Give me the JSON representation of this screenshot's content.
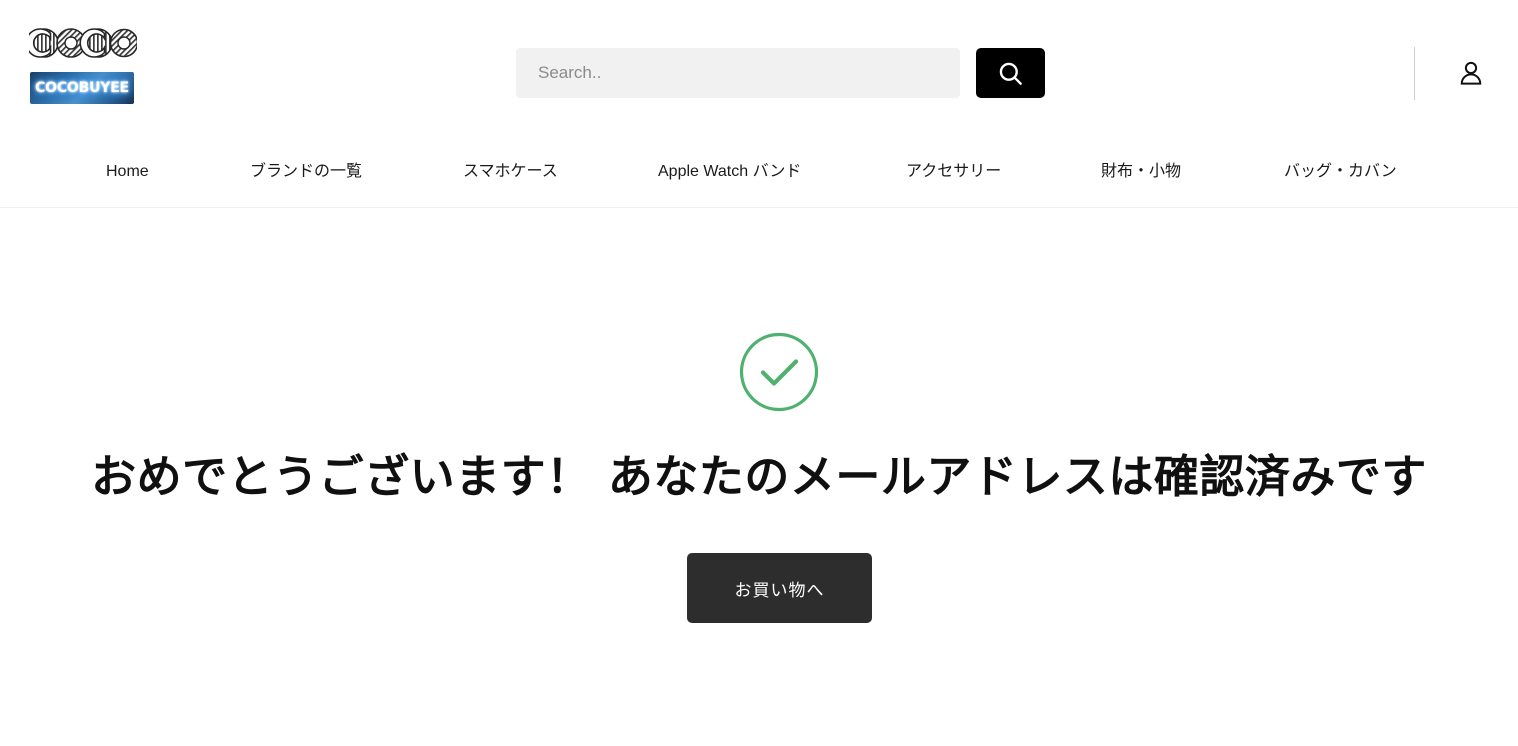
{
  "header": {
    "logo": {
      "wordmark": "COCO",
      "brand_name": "COCOBUYEE"
    },
    "search": {
      "placeholder": "Search..",
      "value": "",
      "button_icon": "search-icon"
    },
    "account": {
      "icon": "user-icon"
    }
  },
  "nav": {
    "items": [
      {
        "label": "Home"
      },
      {
        "label": "ブランドの一覧"
      },
      {
        "label": "スマホケース"
      },
      {
        "label": "Apple Watch バンド"
      },
      {
        "label": "アクセサリー"
      },
      {
        "label": "財布・小物"
      },
      {
        "label": "バッグ・カバン"
      }
    ]
  },
  "main": {
    "status_icon": "check-circle-icon",
    "title": "おめでとうございます！ あなたのメールアドレスは確認済みです",
    "cta_label": "お買い物へ"
  },
  "colors": {
    "success_green": "#4fb16e",
    "button_dark": "#2d2d2d",
    "search_bg": "#f1f1f1",
    "search_button_bg": "#000000",
    "placeholder_gray": "#8b8b8b",
    "divider_gray": "#cfcfcf",
    "neon_blue": "#4aa8ff"
  }
}
